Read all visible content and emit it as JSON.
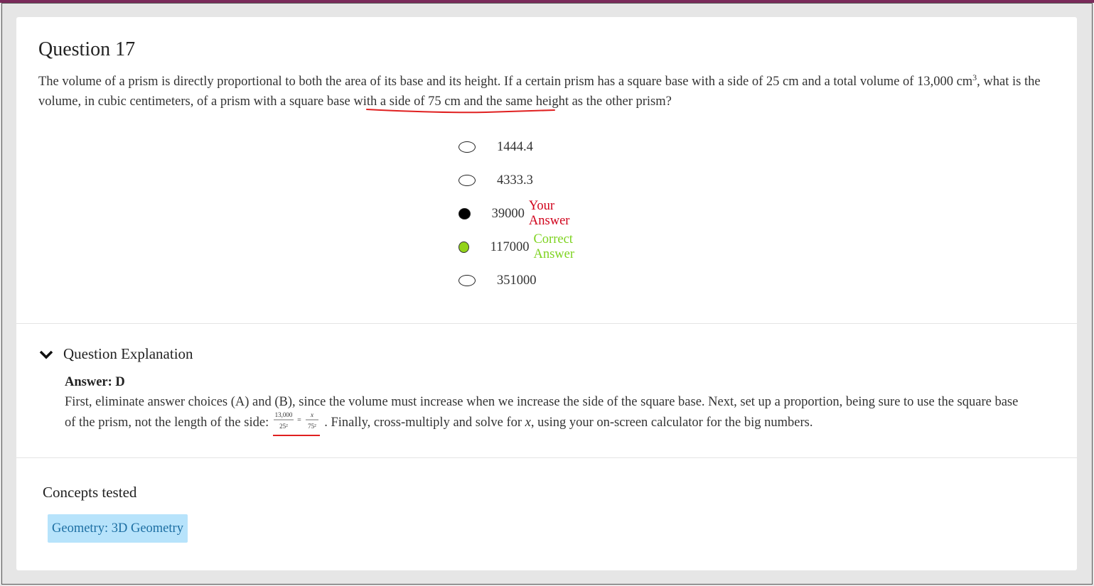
{
  "question": {
    "title": "Question 17",
    "text_part1": "The volume of a prism is directly proportional to both the area of its base and its height. If a certain prism has a square base with a side of 25 cm and a total volume of 13,000 cm",
    "text_sup": "3",
    "text_part2": ", what is the volume, in cubic centimeters, of a prism with a square base with a side of 75 cm and the same height as the other prism?"
  },
  "choices": [
    {
      "value": "1444.4",
      "state": "unselected",
      "tag": ""
    },
    {
      "value": "4333.3",
      "state": "unselected",
      "tag": ""
    },
    {
      "value": "39000",
      "state": "selected",
      "tag": "Your Answer"
    },
    {
      "value": "117000",
      "state": "correct",
      "tag": "Correct Answer"
    },
    {
      "value": "351000",
      "state": "unselected",
      "tag": ""
    }
  ],
  "explanation": {
    "header": "Question Explanation",
    "answer_label": "Answer: D",
    "text_part1": "First, eliminate answer choices (A) and (B), since the volume must increase when we increase the side of the square base. Next, set up a proportion, being sure to use the square base of the prism, not the length of the side:",
    "text_part2": ". Finally, cross-multiply and solve for ",
    "text_var": "x",
    "text_part3": ", using your on-screen calculator for the big numbers.",
    "formula": {
      "num1": "13,000",
      "den1": "25²",
      "num2": "x",
      "den2": "75²"
    }
  },
  "concepts": {
    "title": "Concepts tested",
    "tags": [
      "Geometry: 3D Geometry"
    ]
  },
  "colors": {
    "wrong": "#d0021b",
    "correct": "#7ed321",
    "correct_radio": "#92d319",
    "tag_bg": "#b7e3fb",
    "annotation": "#e02020"
  },
  "icons": {
    "explanation_toggle": "chevron-down-icon"
  }
}
